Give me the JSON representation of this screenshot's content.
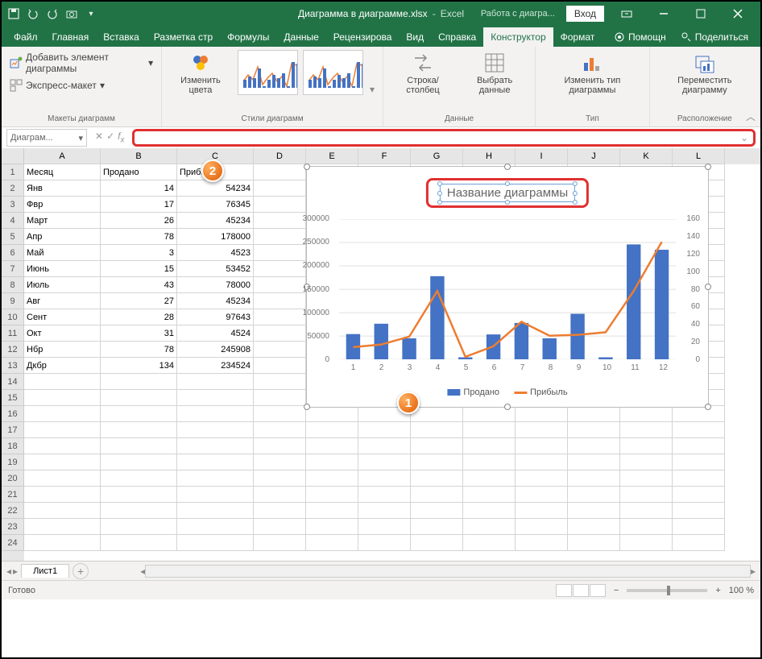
{
  "titlebar": {
    "filename": "Диаграмма в диаграмме.xlsx",
    "app": "Excel",
    "context": "Работа с диагра...",
    "login": "Вход"
  },
  "tabs": {
    "items": [
      "Файл",
      "Главная",
      "Вставка",
      "Разметка стр",
      "Формулы",
      "Данные",
      "Рецензирова",
      "Вид",
      "Справка",
      "Конструктор",
      "Формат"
    ],
    "active_index": 9,
    "help": "Помощн",
    "share": "Поделиться"
  },
  "ribbon": {
    "layout_group": "Макеты диаграмм",
    "add_element": "Добавить элемент диаграммы",
    "express": "Экспресс-макет",
    "styles_group": "Стили диаграмм",
    "change_colors": "Изменить цвета",
    "data_group": "Данные",
    "swap": "Строка/ столбец",
    "select_data": "Выбрать данные",
    "type_group": "Тип",
    "change_type": "Изменить тип диаграммы",
    "loc_group": "Расположение",
    "move": "Переместить диаграмму"
  },
  "namebox": "Диаграм...",
  "sheet": {
    "cols": [
      "A",
      "B",
      "C",
      "D",
      "E",
      "F",
      "G",
      "H",
      "I",
      "J",
      "K",
      "L"
    ],
    "headers": [
      "Месяц",
      "Продано",
      "Прибыль"
    ],
    "rows": [
      [
        "Янв",
        "14",
        "54234"
      ],
      [
        "Фвр",
        "17",
        "76345"
      ],
      [
        "Март",
        "26",
        "45234"
      ],
      [
        "Апр",
        "78",
        "178000"
      ],
      [
        "Май",
        "3",
        "4523"
      ],
      [
        "Июнь",
        "15",
        "53452"
      ],
      [
        "Июль",
        "43",
        "78000"
      ],
      [
        "Авг",
        "27",
        "45234"
      ],
      [
        "Сент",
        "28",
        "97643"
      ],
      [
        "Окт",
        "31",
        "4524"
      ],
      [
        "Нбр",
        "78",
        "245908"
      ],
      [
        "Дкбр",
        "134",
        "234524"
      ]
    ]
  },
  "chart_data": {
    "type": "combo",
    "title": "Название диаграммы",
    "categories": [
      "1",
      "2",
      "3",
      "4",
      "5",
      "6",
      "7",
      "8",
      "9",
      "10",
      "11",
      "12"
    ],
    "series": [
      {
        "name": "Продано",
        "type": "line",
        "axis": "secondary",
        "values": [
          14,
          17,
          26,
          78,
          3,
          15,
          43,
          27,
          28,
          31,
          78,
          134
        ]
      },
      {
        "name": "Прибыль",
        "type": "bar",
        "axis": "primary",
        "values": [
          54234,
          76345,
          45234,
          178000,
          4523,
          53452,
          78000,
          45234,
          97643,
          4524,
          245908,
          234524
        ]
      }
    ],
    "primary_axis": {
      "min": 0,
      "max": 300000,
      "ticks": [
        0,
        50000,
        100000,
        150000,
        200000,
        250000,
        300000
      ]
    },
    "secondary_axis": {
      "min": 0,
      "max": 160,
      "ticks": [
        0,
        20,
        40,
        60,
        80,
        100,
        120,
        140,
        160
      ]
    },
    "legend": [
      "Продано",
      "Прибыль"
    ]
  },
  "sheettab": "Лист1",
  "status": {
    "ready": "Готово",
    "zoom": "100 %"
  }
}
